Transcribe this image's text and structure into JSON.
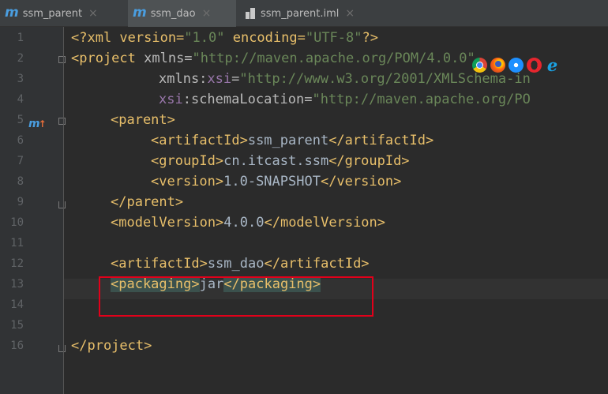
{
  "tabs": [
    {
      "label": "ssm_parent",
      "icon": "maven-m-icon",
      "active": false
    },
    {
      "label": "ssm_dao",
      "icon": "maven-m-icon",
      "active": true
    },
    {
      "label": "ssm_parent.iml",
      "icon": "iml-module-icon",
      "active": false
    }
  ],
  "tab_close_glyph": "×",
  "gutter": {
    "line_numbers": [
      "1",
      "2",
      "3",
      "4",
      "5",
      "6",
      "7",
      "8",
      "9",
      "10",
      "11",
      "12",
      "13",
      "14",
      "15",
      "16"
    ],
    "line5_marker": "m",
    "line5_arrow": "↑"
  },
  "code": {
    "l1": {
      "a": "<?xml version=",
      "b": "\"1.0\"",
      "c": " encoding=",
      "d": "\"UTF-8\"",
      "e": "?>"
    },
    "l2": {
      "a": "<project",
      "b": " xmlns=",
      "c": "\"http://maven.apache.org/POM/4.0.0\""
    },
    "l3": {
      "a": "xmlns:",
      "b": "xsi",
      "c": "=",
      "d": "\"http://www.w3.org/2001/XMLSchema-in"
    },
    "l4": {
      "a": "xsi",
      "b": ":schemaLocation=",
      "c": "\"http://maven.apache.org/PO"
    },
    "l5": {
      "a": "<parent>"
    },
    "l6": {
      "a": "<artifactId>",
      "b": "ssm_parent",
      "c": "</artifactId>"
    },
    "l7": {
      "a": "<groupId>",
      "b": "cn.itcast.ssm",
      "c": "</groupId>"
    },
    "l8": {
      "a": "<version>",
      "b": "1.0-SNAPSHOT",
      "c": "</version>"
    },
    "l9": {
      "a": "</parent>"
    },
    "l10": {
      "a": "<modelVersion>",
      "b": "4.0.0",
      "c": "</modelVersion>"
    },
    "l12": {
      "a": "<artifactId>",
      "b": "ssm_dao",
      "c": "</artifactId>"
    },
    "l13": {
      "a": "<packaging>",
      "b": "jar",
      "c": "</packaging>"
    },
    "l16": {
      "a": "</project>"
    }
  },
  "browser_icons": [
    "chrome-icon",
    "firefox-icon",
    "safari-icon",
    "opera-icon",
    "ie-icon"
  ],
  "ie_glyph": "e",
  "colors": {
    "background": "#2b2b2b",
    "tag": "#e8bf6a",
    "string": "#6a8759",
    "namespace": "#9876aa",
    "highlight_box": "#e2001a"
  }
}
